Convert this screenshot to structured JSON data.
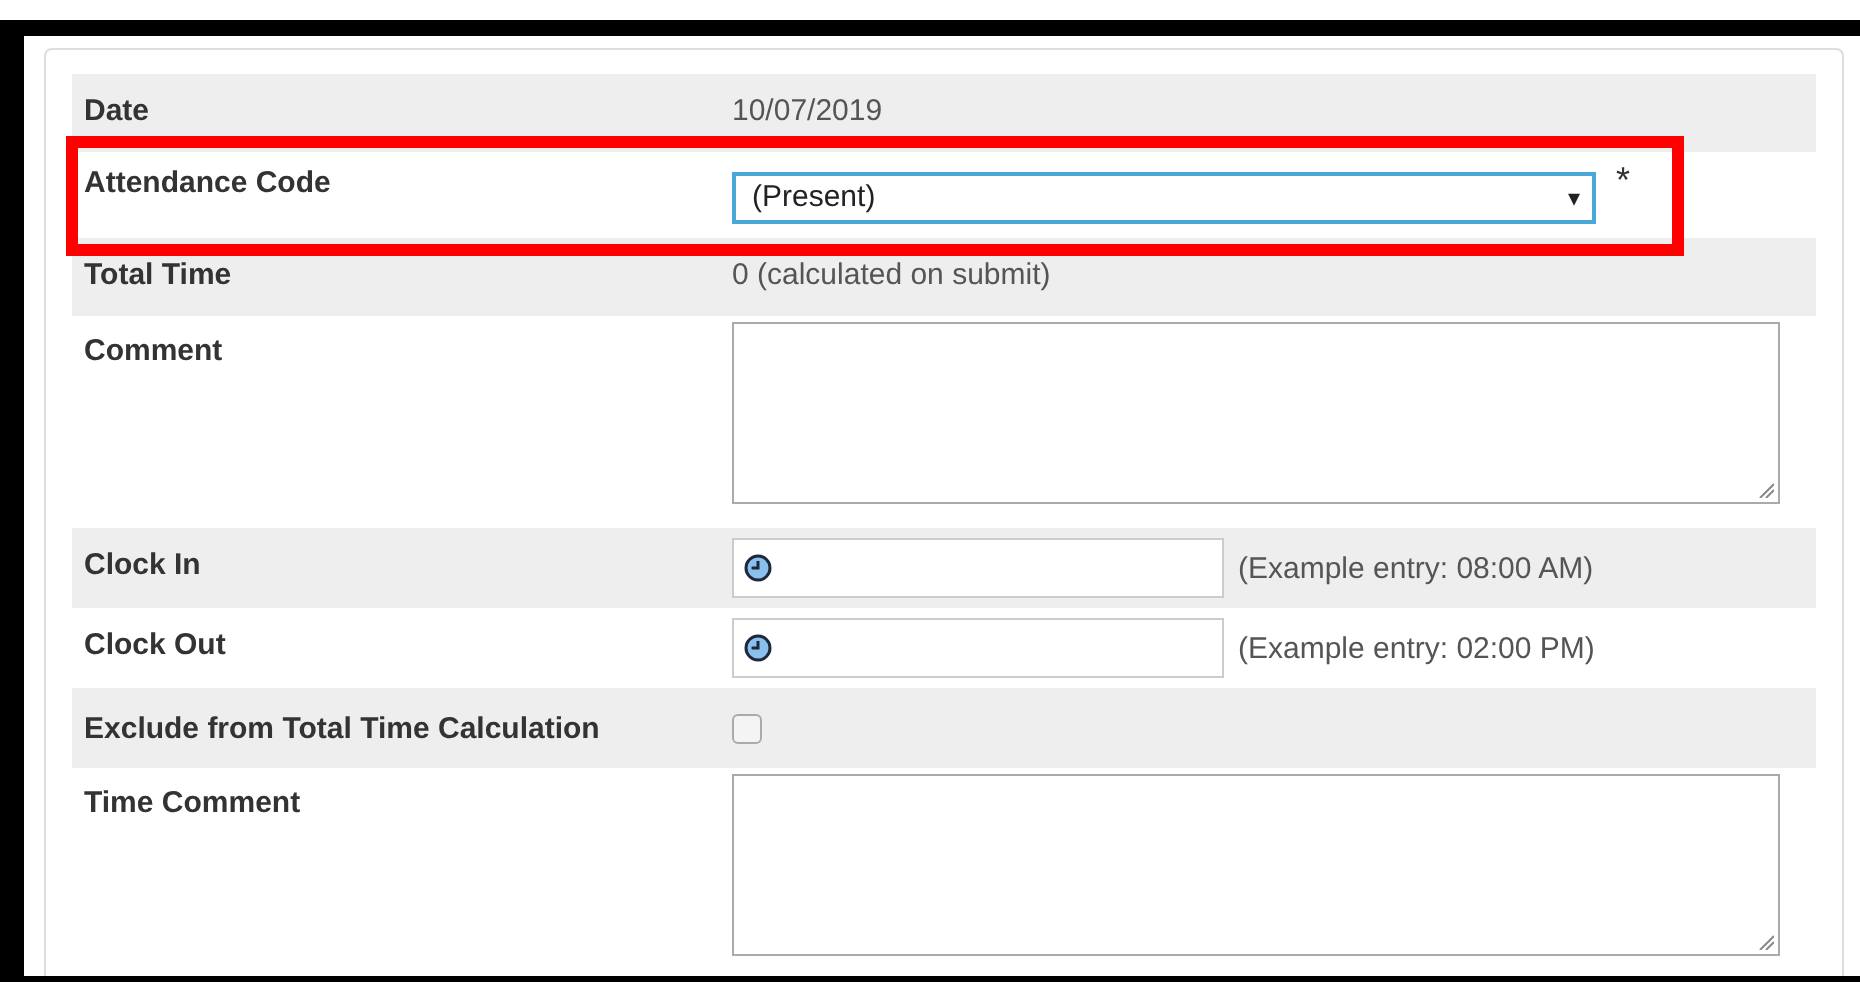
{
  "form": {
    "rows": [
      {
        "kind": "text",
        "label": "Date",
        "value": "10/07/2019",
        "highlighted": false
      },
      {
        "kind": "select",
        "label": "Attendance Code",
        "value": "(Present)",
        "arrow": "▾",
        "required": true,
        "required_mark": "*",
        "highlighted": true
      },
      {
        "kind": "text",
        "label": "Total Time",
        "value": "0 (calculated on submit)",
        "highlighted": false
      },
      {
        "kind": "textarea",
        "label": "Comment",
        "highlighted": false
      },
      {
        "kind": "time",
        "label": "Clock In",
        "hint": "(Example entry: 08:00 AM)",
        "highlighted": false
      },
      {
        "kind": "time",
        "label": "Clock Out",
        "hint": "(Example entry: 02:00 PM)",
        "highlighted": false
      },
      {
        "kind": "checkbox",
        "label": "Exclude from Total Time Calculation",
        "checked": false,
        "highlighted": false
      },
      {
        "kind": "textarea",
        "label": "Time Comment",
        "highlighted": false
      }
    ]
  }
}
